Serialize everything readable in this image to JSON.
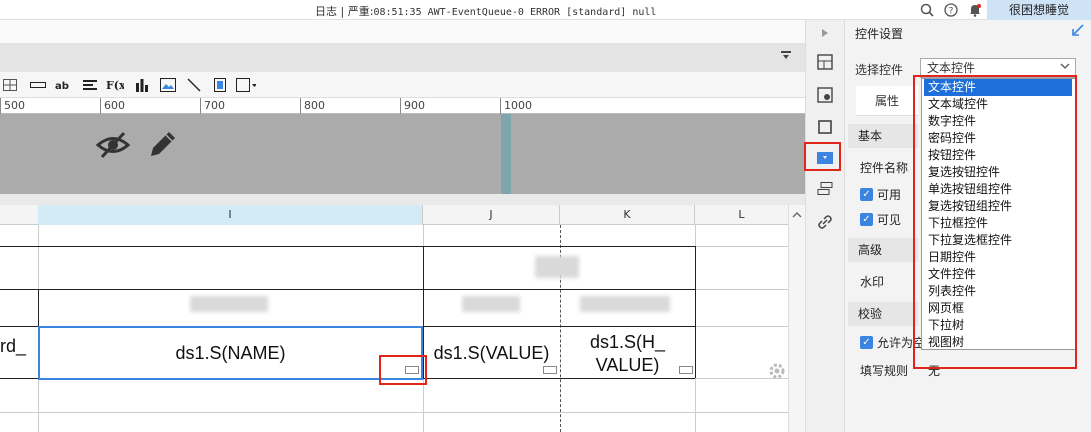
{
  "topbar": {
    "log_label": "日志",
    "separator": "|",
    "severity": "严重:",
    "log_message": "08:51:35 AWT-EventQueue-0 ERROR [standard] null",
    "user": "很困想睡觉"
  },
  "ruler": {
    "ticks": [
      "500",
      "600",
      "700",
      "800",
      "900",
      "1000"
    ]
  },
  "sheet": {
    "columns": [
      "I",
      "J",
      "K",
      "L"
    ],
    "cells": {
      "left_partial": "rd_",
      "i_cell": "ds1.S(NAME)",
      "j_cell": "ds1.S(VALUE)",
      "k_cell_line1": "ds1.S(H_",
      "k_cell_line2": "VALUE)"
    }
  },
  "panel": {
    "title": "控件设置",
    "select_label": "选择控件",
    "select_value": "文本控件",
    "tab": "属性",
    "sections": {
      "basic": "基本",
      "advanced": "高级",
      "validate": "校验"
    },
    "labels": {
      "widget_name": "控件名称",
      "enabled": "可用",
      "visible": "可见",
      "watermark": "水印",
      "allow_empty": "允许为空",
      "fill_rule": "填写规则",
      "fill_rule_value": "无"
    }
  },
  "dropdown": {
    "selected": "文本控件",
    "options": [
      "文本控件",
      "文本域控件",
      "数字控件",
      "密码控件",
      "按钮控件",
      "复选按钮控件",
      "单选按钮组控件",
      "复选按钮组控件",
      "下拉框控件",
      "下拉复选框控件",
      "日期控件",
      "文件控件",
      "列表控件",
      "网页框",
      "下拉树",
      "视图树"
    ]
  },
  "colors": {
    "accent": "#3b84e0",
    "highlight_red": "#e0261c",
    "band": "#ababab",
    "marker": "#7fa5ad"
  },
  "icons": [
    "search-icon",
    "help-icon",
    "bell-icon",
    "eye-off-icon",
    "pencil-icon",
    "gear-icon",
    "chevron-down-icon"
  ]
}
